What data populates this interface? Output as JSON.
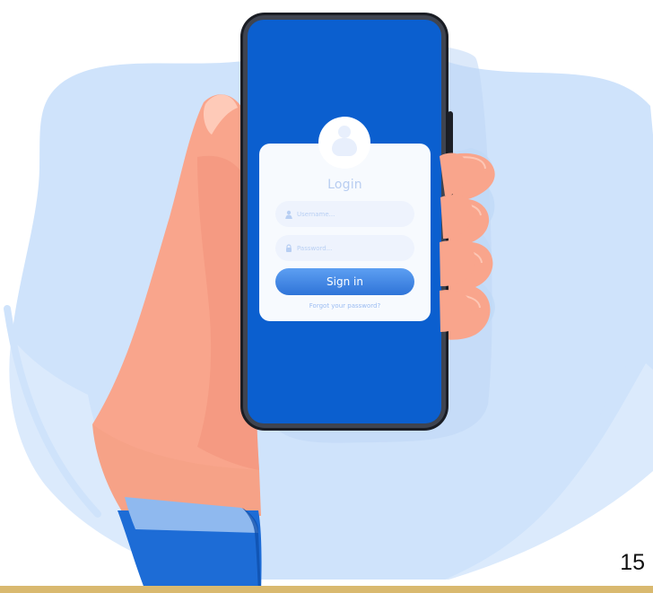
{
  "login": {
    "title": "Login",
    "username_placeholder": "Username...",
    "password_placeholder": "Password...",
    "signin_label": "Sign in",
    "forgot_label": "Forgot your password?"
  },
  "page_number": "15",
  "colors": {
    "phone_screen": "#0b5fcf",
    "background_blob": "#cfe3fb",
    "card": "#ffffff",
    "button": "#3d82e0",
    "skin": "#f9a58c",
    "sleeve": "#1d6cd6",
    "bottom_band": "#d9b96f"
  },
  "icons": {
    "username": "user-icon",
    "password": "lock-icon",
    "avatar": "avatar-icon"
  }
}
